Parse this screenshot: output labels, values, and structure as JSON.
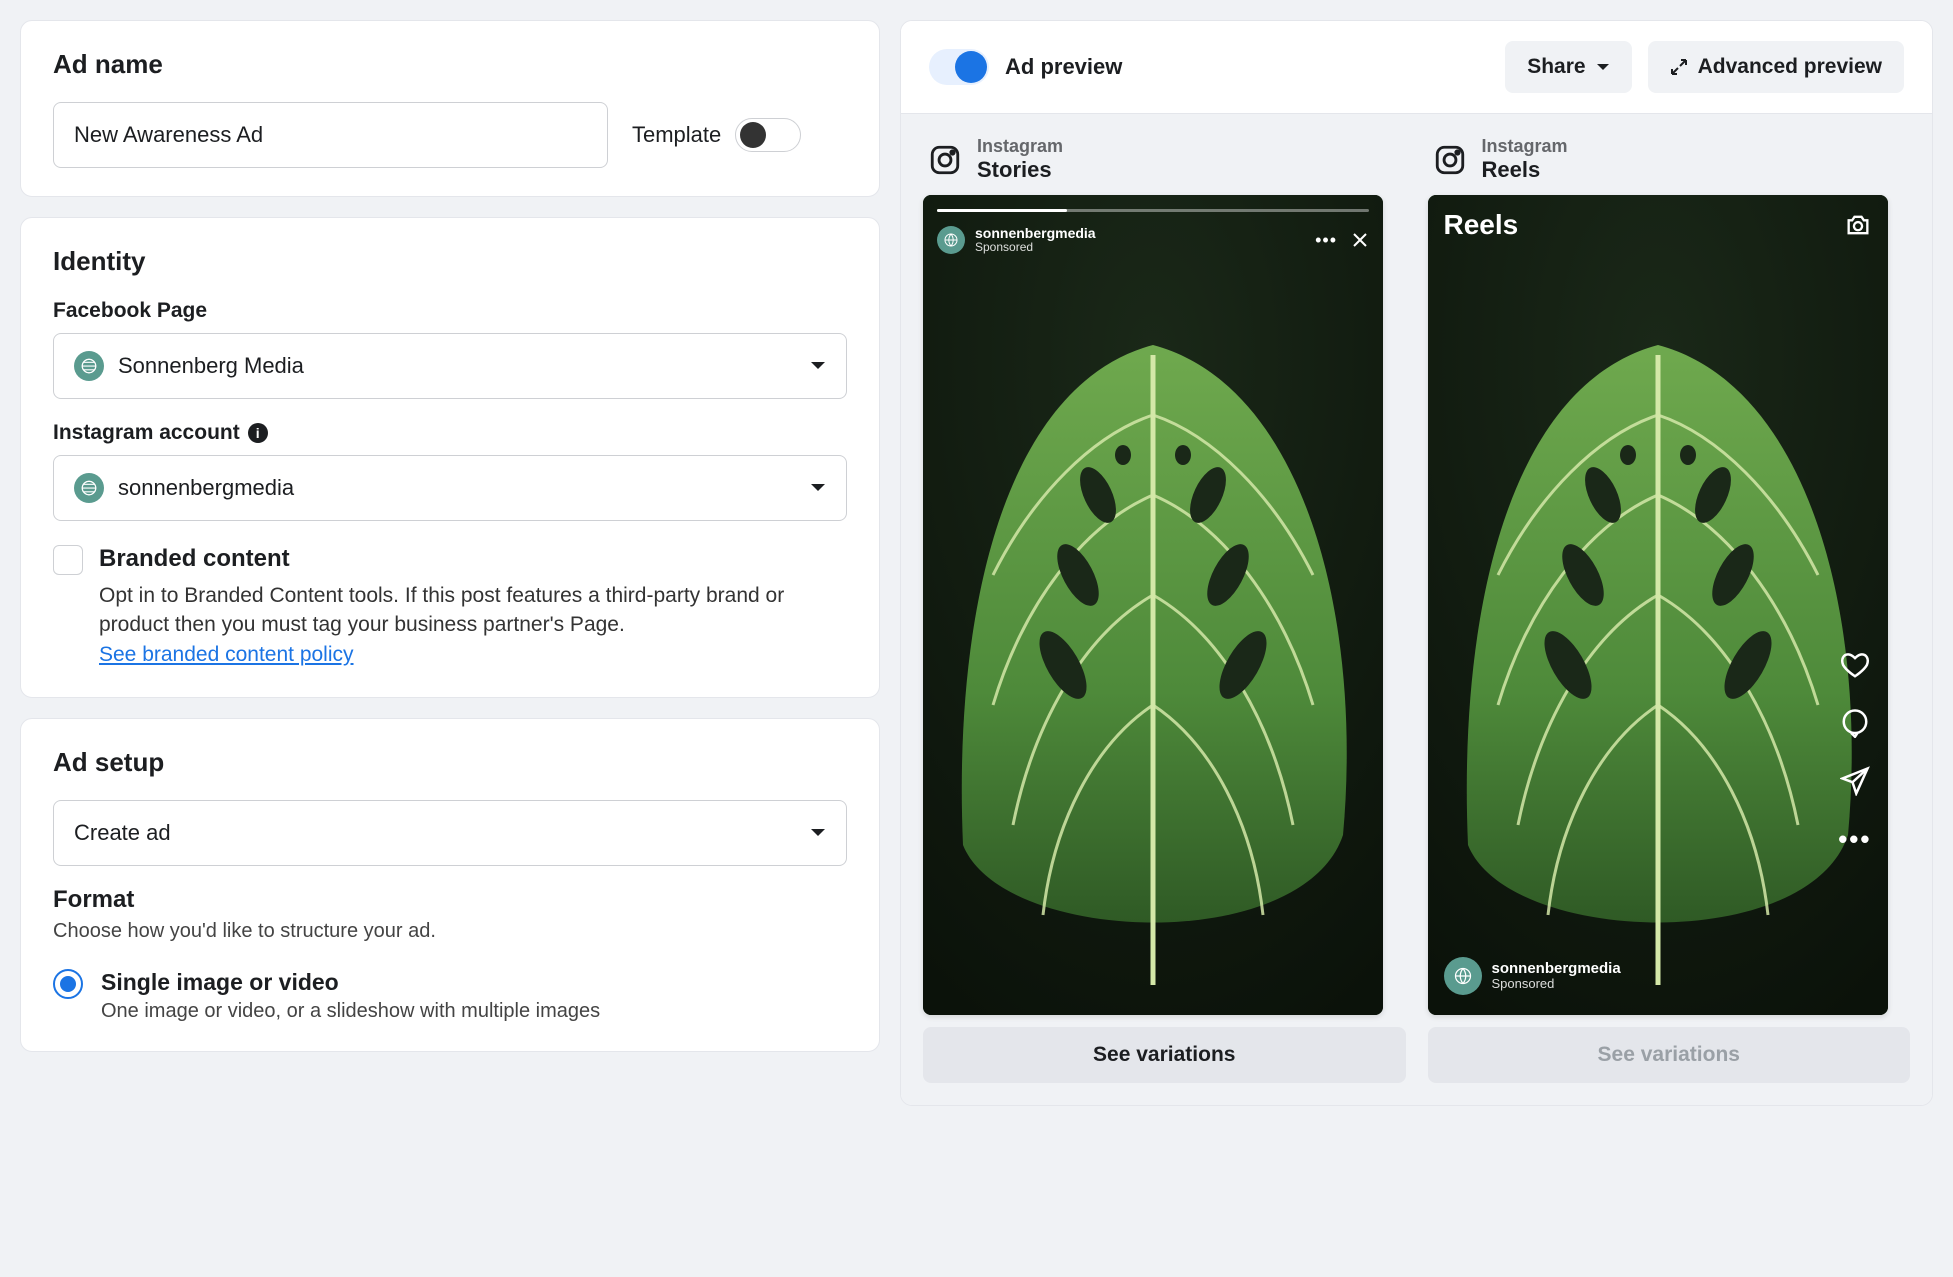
{
  "adName": {
    "title": "Ad name",
    "value": "New Awareness Ad",
    "templateLabel": "Template"
  },
  "identity": {
    "title": "Identity",
    "fbPageLabel": "Facebook Page",
    "fbPageValue": "Sonnenberg Media",
    "igLabel": "Instagram account",
    "igValue": "sonnenbergmedia",
    "branded": {
      "title": "Branded content",
      "desc": "Opt in to Branded Content tools. If this post features a third-party brand or product then you must tag your business partner's Page.",
      "link": "See branded content policy"
    }
  },
  "adSetup": {
    "title": "Ad setup",
    "createValue": "Create ad",
    "formatTitle": "Format",
    "formatDesc": "Choose how you'd like to structure your ad.",
    "options": [
      {
        "title": "Single image or video",
        "desc": "One image or video, or a slideshow with multiple images"
      }
    ]
  },
  "preview": {
    "title": "Ad preview",
    "share": "Share",
    "advanced": "Advanced preview",
    "seeVariations": "See variations",
    "stories": {
      "platform": "Instagram",
      "placement": "Stories",
      "user": "sonnenbergmedia",
      "sponsored": "Sponsored"
    },
    "reels": {
      "platform": "Instagram",
      "placement": "Reels",
      "overlayTitle": "Reels",
      "user": "sonnenbergmedia",
      "sponsored": "Sponsored"
    }
  }
}
